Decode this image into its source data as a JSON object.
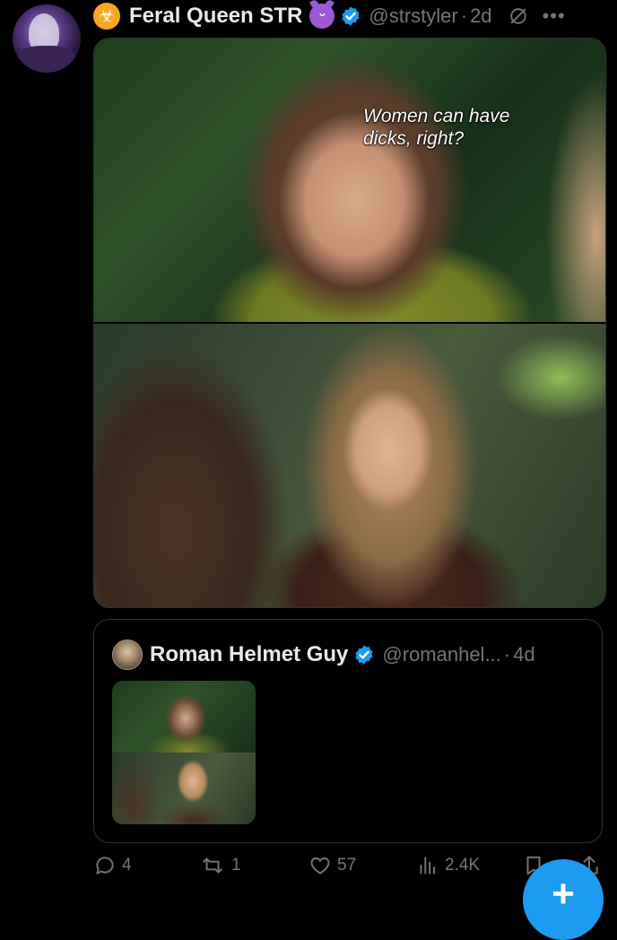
{
  "post": {
    "author": {
      "display_name": "Feral Queen STR",
      "handle": "@strstyler",
      "time": "2d",
      "separator": "·",
      "badge_icons": [
        "biohazard-icon",
        "smiling-devil-icon",
        "verified-icon"
      ]
    },
    "media": {
      "caption": "Women can have dicks, right?"
    }
  },
  "quoted_post": {
    "display_name": "Roman Helmet Guy",
    "handle": "@romanhel...",
    "separator": "·",
    "time": "4d"
  },
  "actions": {
    "replies": "4",
    "reposts": "1",
    "likes": "57",
    "views": "2.4K"
  },
  "colors": {
    "background": "#000000",
    "text_primary": "#e7e9ea",
    "text_secondary": "#71767b",
    "accent_blue": "#1d9bf0",
    "border": "#2f3336"
  },
  "compose_button": {
    "label": "+"
  }
}
